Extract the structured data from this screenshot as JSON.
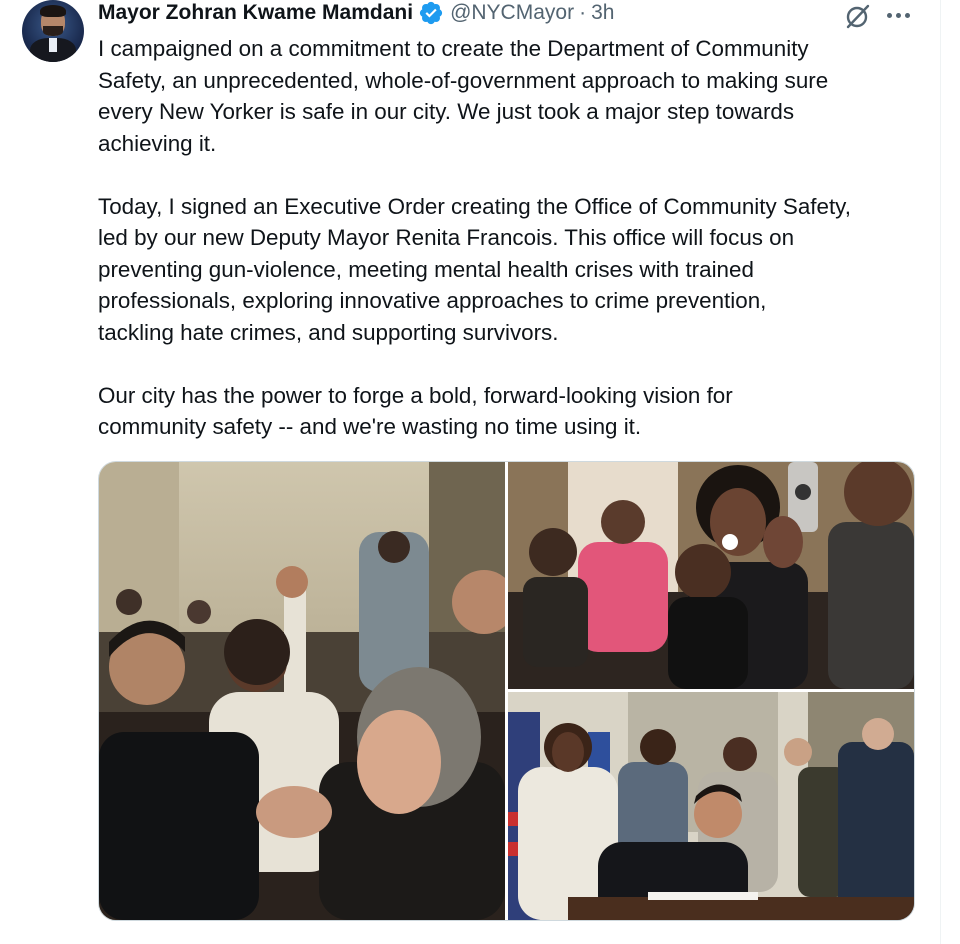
{
  "author": {
    "display_name": "Mayor Zohran Kwame Mamdani",
    "handle": "@NYCMayor",
    "separator": "·",
    "timestamp": "3h",
    "verified": true,
    "verified_badge_color": "#1d9bf0"
  },
  "icons": {
    "avatar": "avatar-portrait",
    "verified": "verified-badge-icon",
    "grok": "grok-icon",
    "more": "more-dots-icon"
  },
  "tweet": {
    "paragraphs": [
      "I campaigned on a commitment to create the Department of Community\nSafety, an unprecedented, whole-of-government approach to making sure\nevery New Yorker is safe in our city. We just took a major step towards\nachieving it.",
      "Today, I signed an Executive Order creating the Office of Community Safety,\nled by our new Deputy Mayor Renita Francois. This office will focus on\npreventing gun-violence, meeting mental health crises with trained\nprofessionals, exploring innovative approaches to crime prevention,\ntackling hate crimes, and supporting survivors.",
      "Our city has the power to forge a bold, forward-looking vision for\ncommunity safety -- and we're wasting no time using it."
    ]
  },
  "media": {
    "count": 3,
    "layout": "one-large-left-two-stacked-right"
  },
  "colors": {
    "text_primary": "#0f1419",
    "text_secondary": "#536471",
    "border": "#cfd9de",
    "accent": "#1d9bf0"
  }
}
